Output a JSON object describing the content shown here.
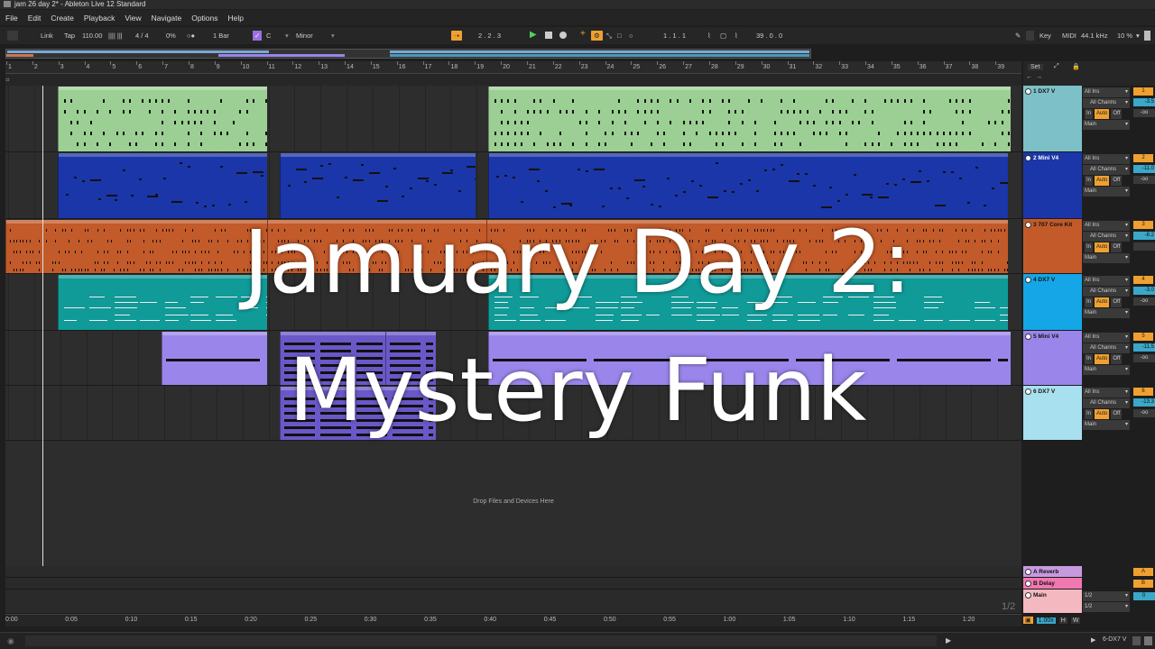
{
  "window": {
    "title": "jam 26 day 2* - Ableton Live 12 Standard"
  },
  "menu": [
    "File",
    "Edit",
    "Create",
    "Playback",
    "View",
    "Navigate",
    "Options",
    "Help"
  ],
  "control": {
    "link": "Link",
    "tap": "Tap",
    "tempo": "110.00",
    "meter_icon": "|||| |||",
    "signature": "4 / 4",
    "groove": "0%",
    "metronome": "○●",
    "quantize": "1 Bar",
    "key_root": "C",
    "scale": "Minor",
    "position": "2 .   2 .   3",
    "loop_start": "1 .   1 .   1",
    "loop_length": "39 .   0 .   0",
    "key_label": "Key",
    "midi_label": "MIDI",
    "sample_rate": "44.1 kHz",
    "cpu": "10 %"
  },
  "ruler": {
    "bars": [
      "1",
      "2",
      "3",
      "4",
      "5",
      "6",
      "7",
      "8",
      "9",
      "10",
      "11",
      "12",
      "13",
      "14",
      "15",
      "16",
      "17",
      "18",
      "19",
      "20",
      "21",
      "22",
      "23",
      "24",
      "25",
      "26",
      "27",
      "28",
      "29",
      "30",
      "31",
      "32",
      "33",
      "34",
      "35",
      "36",
      "37",
      "38",
      "39"
    ]
  },
  "set_panel": {
    "label": "Set"
  },
  "tracks": [
    {
      "name": "1 DX7 V",
      "color": "#9ccf94",
      "header_color": "#7ec0c8",
      "input": "All Ins",
      "channel": "All Channs",
      "monitor_in": "In",
      "monitor_auto": "Auto",
      "monitor_off": "Off",
      "output": "Main",
      "number": "1",
      "volume": "-3.5",
      "pan": "-oo"
    },
    {
      "name": "2 Mini V4",
      "color": "#1a36a8",
      "header_color": "#1a36a8",
      "input": "All Ins",
      "channel": "All Channs",
      "monitor_in": "In",
      "monitor_auto": "Auto",
      "monitor_off": "Off",
      "output": "Main",
      "number": "2",
      "volume": "-11.0",
      "pan": "-oo"
    },
    {
      "name": "3 707 Core Kit",
      "color": "#c25a2a",
      "header_color": "#c25a2a",
      "input": "All Ins",
      "channel": "All Channs",
      "monitor_in": "In",
      "monitor_auto": "Auto",
      "monitor_off": "Off",
      "output": "Main",
      "number": "3",
      "volume": "-8.2",
      "pan": ""
    },
    {
      "name": "4 DX7 V",
      "color": "#109a98",
      "header_color": "#14a6e6",
      "input": "All Ins",
      "channel": "All Channs",
      "monitor_in": "In",
      "monitor_auto": "Auto",
      "monitor_off": "Off",
      "output": "Main",
      "number": "4",
      "volume": "-3.0",
      "pan": "-oo"
    },
    {
      "name": "5 Mini V4",
      "color": "#9a86ea",
      "header_color": "#9a86ea",
      "input": "All Ins",
      "channel": "All Channs",
      "monitor_in": "In",
      "monitor_auto": "Auto",
      "monitor_off": "Off",
      "output": "Main",
      "number": "5",
      "volume": "-11.5",
      "pan": "-oo"
    },
    {
      "name": "6 DX7 V",
      "color": "#8ad0ec",
      "header_color": "#a8e0f0",
      "input": "All Ins",
      "channel": "All Channs",
      "monitor_in": "In",
      "monitor_auto": "Auto",
      "monitor_off": "Off",
      "output": "Main",
      "number": "6",
      "volume": "-13.3",
      "pan": "-oo"
    }
  ],
  "drop_hint": "Drop Files and Devices Here",
  "returns": [
    {
      "name": "A Reverb",
      "letter": "A",
      "color": "#c79ae0"
    },
    {
      "name": "B Delay",
      "letter": "B",
      "color": "#f078b0"
    }
  ],
  "main_track": {
    "name": "Main",
    "color": "#f4b8c0",
    "output_a": "1/2",
    "output_b": "1/2",
    "number": "0"
  },
  "time_ruler": [
    "0:00",
    "0:05",
    "0:10",
    "0:15",
    "0:20",
    "0:25",
    "0:30",
    "0:35",
    "0:40",
    "0:45",
    "0:50",
    "0:55",
    "1:00",
    "1:05",
    "1:10",
    "1:15",
    "1:20"
  ],
  "pager": "1/2",
  "zoom": "1.00x",
  "status_track": "6-DX7 V",
  "overlay": {
    "line1": "Jamuary Day 2:",
    "line2": "Mystery Funk"
  }
}
